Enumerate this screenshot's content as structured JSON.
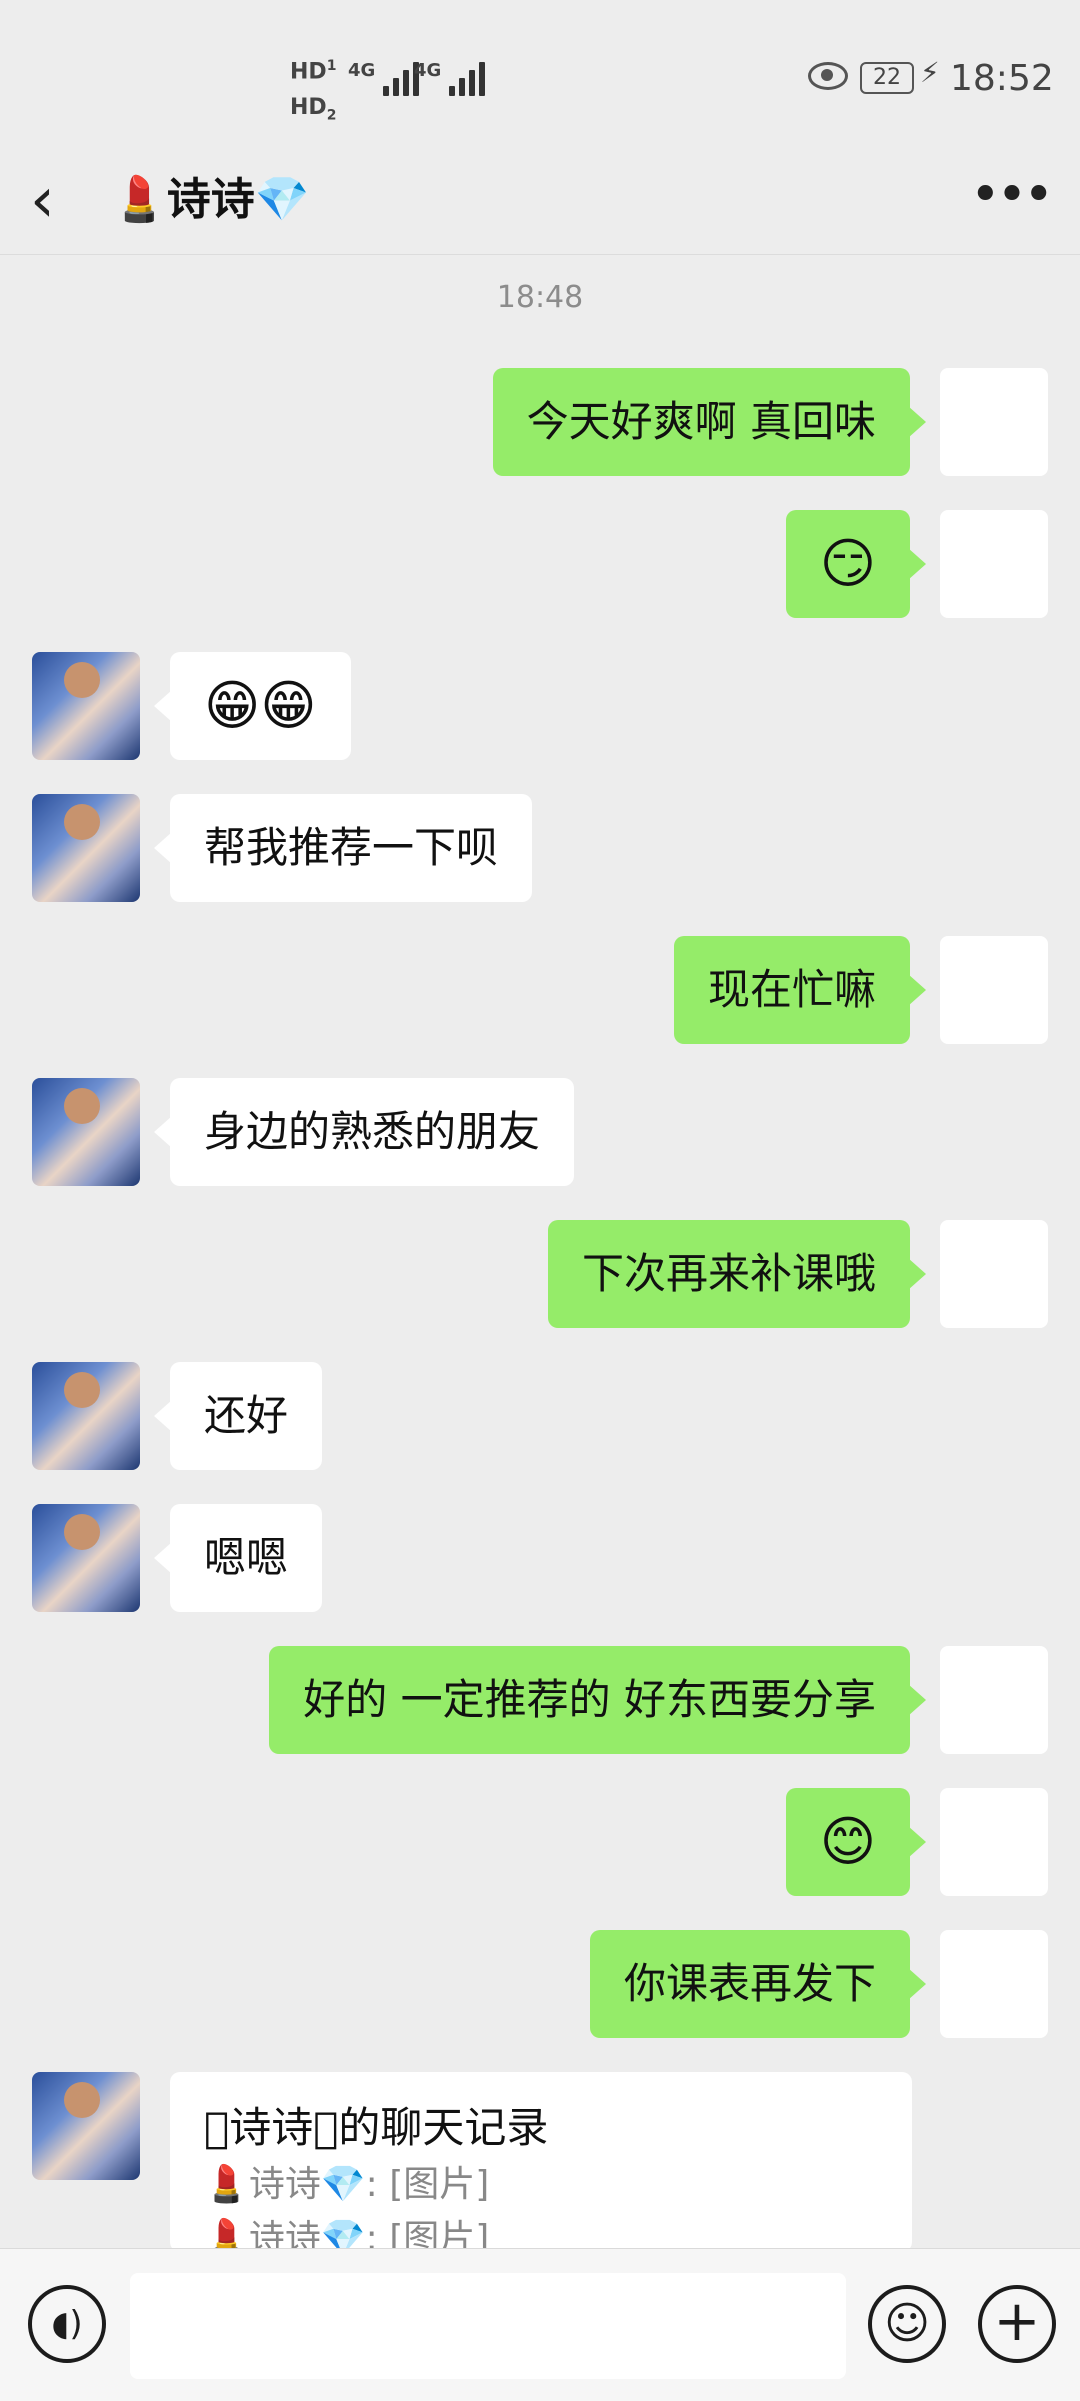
{
  "status_bar": {
    "sim1": "HD",
    "sim1_num": "1",
    "sim2": "HD",
    "sim2_num": "2",
    "net1": "4G",
    "net2": "4G",
    "battery": "22",
    "time": "18:52"
  },
  "header": {
    "back_icon": "chevron-left-icon",
    "title": "💄诗诗💎",
    "more_icon": "ellipsis-icon"
  },
  "chat": {
    "timestamp": "18:48",
    "messages": [
      {
        "side": "out",
        "text": "今天好爽啊  真回味"
      },
      {
        "side": "out",
        "text": "😏"
      },
      {
        "side": "in",
        "text": "😁😁"
      },
      {
        "side": "in",
        "text": "帮我推荐一下呗"
      },
      {
        "side": "out",
        "text": "现在忙嘛"
      },
      {
        "side": "in",
        "text": "身边的熟悉的朋友"
      },
      {
        "side": "out",
        "text": "下次再来补课哦"
      },
      {
        "side": "in",
        "text": "还好"
      },
      {
        "side": "in",
        "text": "嗯嗯"
      },
      {
        "side": "out",
        "text": "好的 一定推荐的 好东西要分享"
      },
      {
        "side": "out",
        "text": "😊"
      },
      {
        "side": "out",
        "text": "你课表再发下"
      }
    ],
    "record_card": {
      "title": "\u0000诗诗\u0000的聊天记录",
      "line1": "💄诗诗💎: [图片]",
      "line2": "💄诗诗💎: [图片]"
    }
  },
  "input_bar": {
    "voice_icon": "voice-icon",
    "emoji_icon": "smiley-icon",
    "plus_icon": "plus-icon"
  },
  "colors": {
    "outgoing_bubble": "#95ec69",
    "incoming_bubble": "#ffffff",
    "background": "#ededed"
  }
}
